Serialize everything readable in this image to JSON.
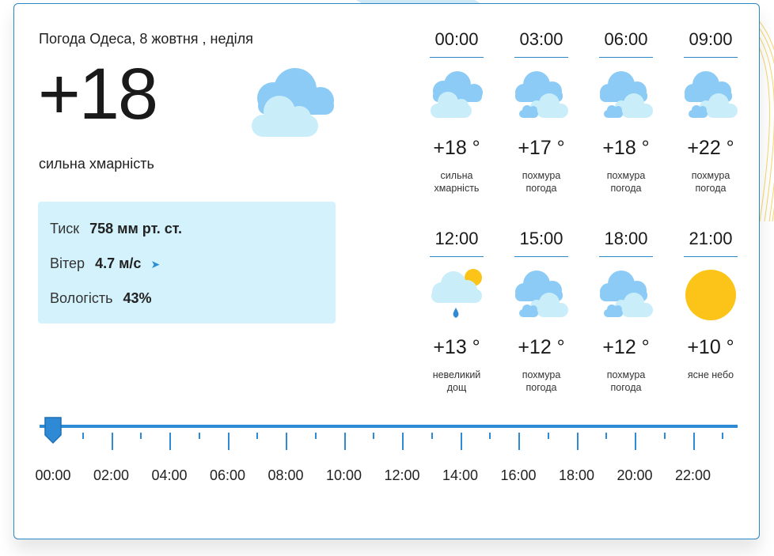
{
  "title": "Погода Одеса, 8 жовтня , неділя",
  "current": {
    "temperature": "+18",
    "condition": "сильна хмарність",
    "icon": "cloud-icon"
  },
  "details": {
    "pressure_label": "Тиск",
    "pressure_value": "758 мм рт. ст.",
    "wind_label": "Вітер",
    "wind_value": "4.7 м/с",
    "wind_icon": "wind-direction-arrow-icon",
    "humidity_label": "Вологість",
    "humidity_value": "43%"
  },
  "hourly": [
    {
      "time": "00:00",
      "temp": "+18 °",
      "desc": [
        "сильна",
        "хмарність"
      ],
      "icon": "overcast-cloud-icon"
    },
    {
      "time": "03:00",
      "temp": "+17 °",
      "desc": [
        "похмура",
        "погода"
      ],
      "icon": "cloudy-icon"
    },
    {
      "time": "06:00",
      "temp": "+18 °",
      "desc": [
        "похмура",
        "погода"
      ],
      "icon": "cloudy-icon"
    },
    {
      "time": "09:00",
      "temp": "+22 °",
      "desc": [
        "похмура",
        "погода"
      ],
      "icon": "cloudy-icon"
    },
    {
      "time": "12:00",
      "temp": "+13 °",
      "desc": [
        "невеликий",
        "дощ"
      ],
      "icon": "light-rain-icon"
    },
    {
      "time": "15:00",
      "temp": "+12 °",
      "desc": [
        "похмура",
        "погода"
      ],
      "icon": "cloudy-icon"
    },
    {
      "time": "18:00",
      "temp": "+12 °",
      "desc": [
        "похмура",
        "погода"
      ],
      "icon": "cloudy-icon"
    },
    {
      "time": "21:00",
      "temp": "+10 °",
      "desc": [
        "ясне небо"
      ],
      "icon": "sun-icon"
    }
  ],
  "timeline": {
    "labels": [
      "00:00",
      "02:00",
      "04:00",
      "06:00",
      "08:00",
      "10:00",
      "12:00",
      "14:00",
      "16:00",
      "18:00",
      "20:00",
      "22:00"
    ],
    "selected": "00:00"
  },
  "colors": {
    "accent": "#2f8ad6",
    "info_bg": "#d3f2fc",
    "cloud_dark": "#8ccbf5",
    "cloud_light": "#c9eefa",
    "sun": "#fcc419"
  }
}
